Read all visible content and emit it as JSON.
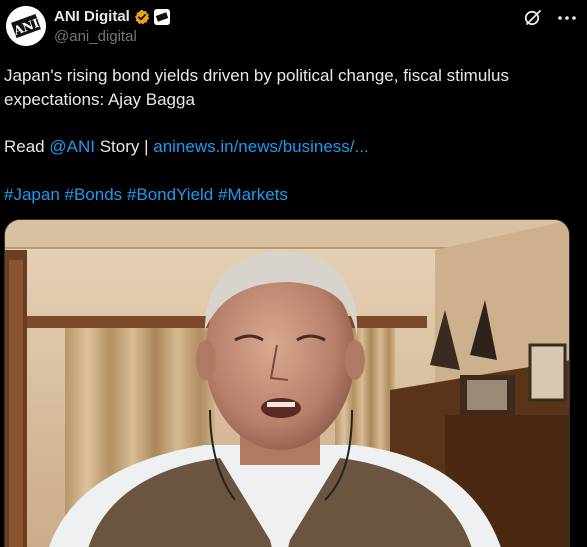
{
  "tweet": {
    "author_name": "ANI Digital",
    "author_handle": "@ani_digital",
    "avatar_text": "ANI",
    "body_line1": "Japan's rising bond yields driven by political change, fiscal stimulus",
    "body_line2": "expectations: Ajay Bagga",
    "read_prefix": "Read ",
    "mention": "@ANI",
    "story_text": " Story | ",
    "link_text": "aninews.in/news/business/...",
    "hashtags": [
      "#Japan",
      "#Bonds",
      "#BondYield",
      "#Markets"
    ]
  },
  "icons": {
    "verified": "verified-badge-icon",
    "affiliate": "affiliate-badge-icon",
    "grok": "grok-icon",
    "more": "more-options-icon"
  },
  "colors": {
    "background": "#000000",
    "text": "#e7e9ea",
    "secondary": "#71767b",
    "link": "#1d9bf0",
    "verified": "#e8a317"
  }
}
